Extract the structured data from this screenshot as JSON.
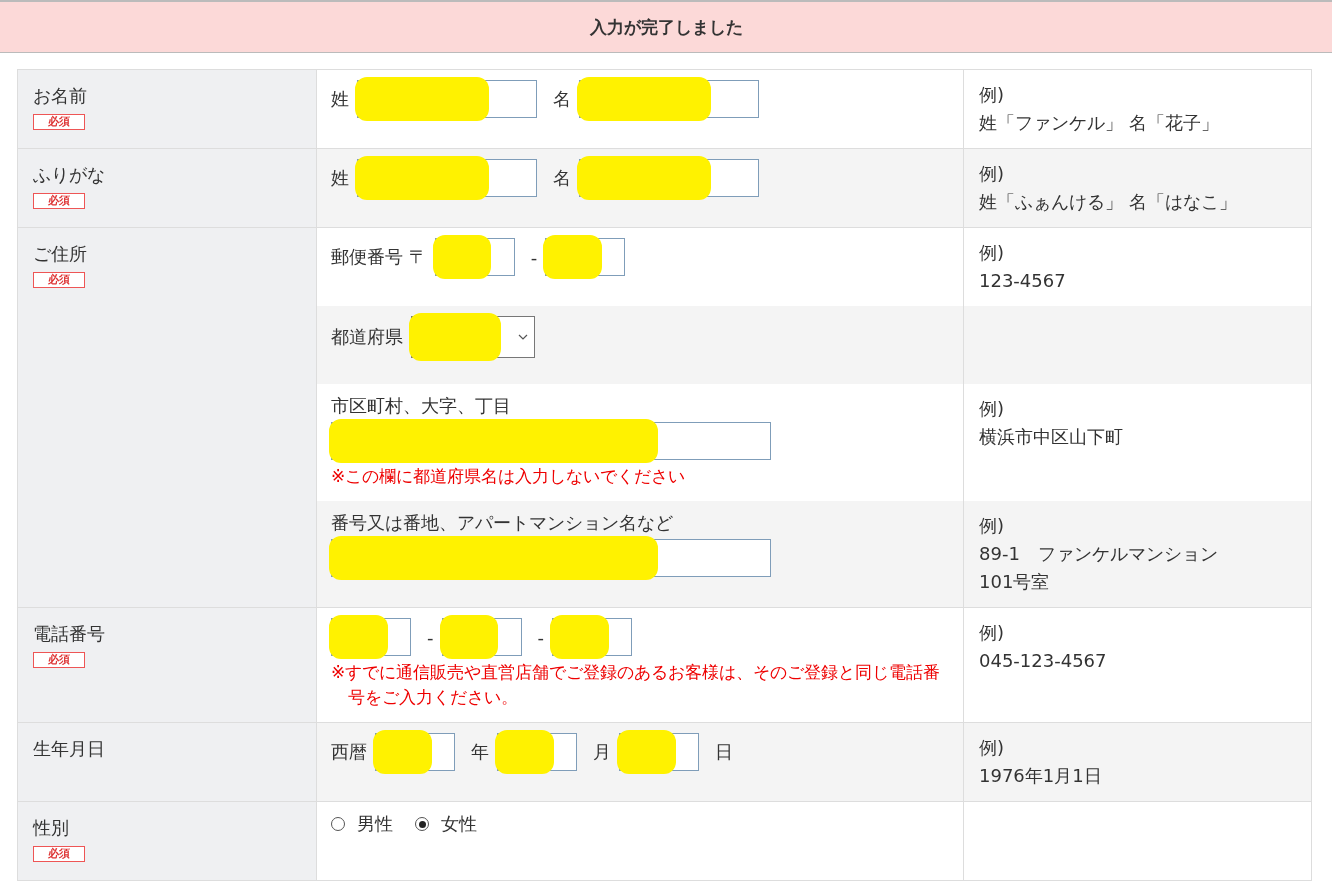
{
  "banner": {
    "text": "入力が完了しました"
  },
  "rows": [
    {
      "label": "お名前",
      "required": "必須",
      "subrows": [
        {
          "lines": [
            [
              {
                "kind": "label",
                "text": "姓"
              },
              {
                "kind": "input",
                "redacted": true
              },
              {
                "kind": "label",
                "text": "名"
              },
              {
                "kind": "input",
                "redacted": true
              }
            ]
          ],
          "example": [
            "例)",
            "姓「ファンケル」 名「花子」"
          ]
        }
      ]
    },
    {
      "label": "ふりがな",
      "required": "必須",
      "subrows": [
        {
          "lines": [
            [
              {
                "kind": "label",
                "text": "姓"
              },
              {
                "kind": "input",
                "redacted": true
              },
              {
                "kind": "label",
                "text": "名"
              },
              {
                "kind": "input",
                "redacted": true
              }
            ]
          ],
          "example": [
            "例)",
            "姓「ふぁんける」 名「はなこ」"
          ]
        }
      ]
    },
    {
      "label": "ご住所",
      "required": "必須",
      "subrows": [
        {
          "lines": [
            [
              {
                "kind": "label",
                "text": "郵便番号 〒"
              },
              {
                "kind": "short-input",
                "redacted": true
              },
              {
                "kind": "label",
                "text": "-"
              },
              {
                "kind": "short-input",
                "redacted": true
              }
            ]
          ],
          "example": [
            "例)",
            "123-4567"
          ]
        },
        {
          "lines": [
            [
              {
                "kind": "label",
                "text": "都道府県"
              },
              {
                "kind": "select",
                "redacted": true
              }
            ]
          ],
          "example": []
        },
        {
          "lines": [
            [
              {
                "kind": "label",
                "text": "市区町村、大字、丁目"
              }
            ],
            [
              {
                "kind": "long-input",
                "redacted": true
              }
            ],
            [
              {
                "kind": "note",
                "text": "※この欄に都道府県名は入力しないでください"
              }
            ]
          ],
          "example": [
            "例)",
            "横浜市中区山下町"
          ]
        },
        {
          "lines": [
            [
              {
                "kind": "label",
                "text": "番号又は番地、アパートマンション名など"
              }
            ],
            [
              {
                "kind": "long-input",
                "redacted": true
              }
            ]
          ],
          "example": [
            "例)",
            "89-1　ファンケルマンション",
            "101号室"
          ]
        }
      ]
    },
    {
      "label": "電話番号",
      "required": "必須",
      "subrows": [
        {
          "lines": [
            [
              {
                "kind": "short-input",
                "redacted": true
              },
              {
                "kind": "label",
                "text": "-"
              },
              {
                "kind": "short-input",
                "redacted": true
              },
              {
                "kind": "label",
                "text": "-"
              },
              {
                "kind": "short-input",
                "redacted": true
              }
            ],
            [
              {
                "kind": "note",
                "text": "※すでに通信販売や直営店舗でご登録のあるお客様は、そのご登録と同じ電話番号をご入力ください。"
              }
            ]
          ],
          "example": [
            "例)",
            "045-123-4567"
          ]
        }
      ]
    },
    {
      "label": "生年月日",
      "subrows": [
        {
          "lines": [
            [
              {
                "kind": "label",
                "text": "西暦"
              },
              {
                "kind": "short-input",
                "redacted": true
              },
              {
                "kind": "label",
                "text": "年"
              },
              {
                "kind": "short-input",
                "redacted": true
              },
              {
                "kind": "label",
                "text": "月"
              },
              {
                "kind": "short-input",
                "redacted": true
              },
              {
                "kind": "label",
                "text": "日"
              }
            ]
          ],
          "example": [
            "例)",
            "1976年1月1日"
          ]
        }
      ]
    },
    {
      "label": "性別",
      "required": "必須",
      "subrows": [
        {
          "lines": [
            [
              {
                "kind": "radio",
                "text": "男性",
                "selected": false
              },
              {
                "kind": "radio",
                "text": "女性",
                "selected": true
              }
            ]
          ],
          "example": []
        }
      ]
    }
  ]
}
